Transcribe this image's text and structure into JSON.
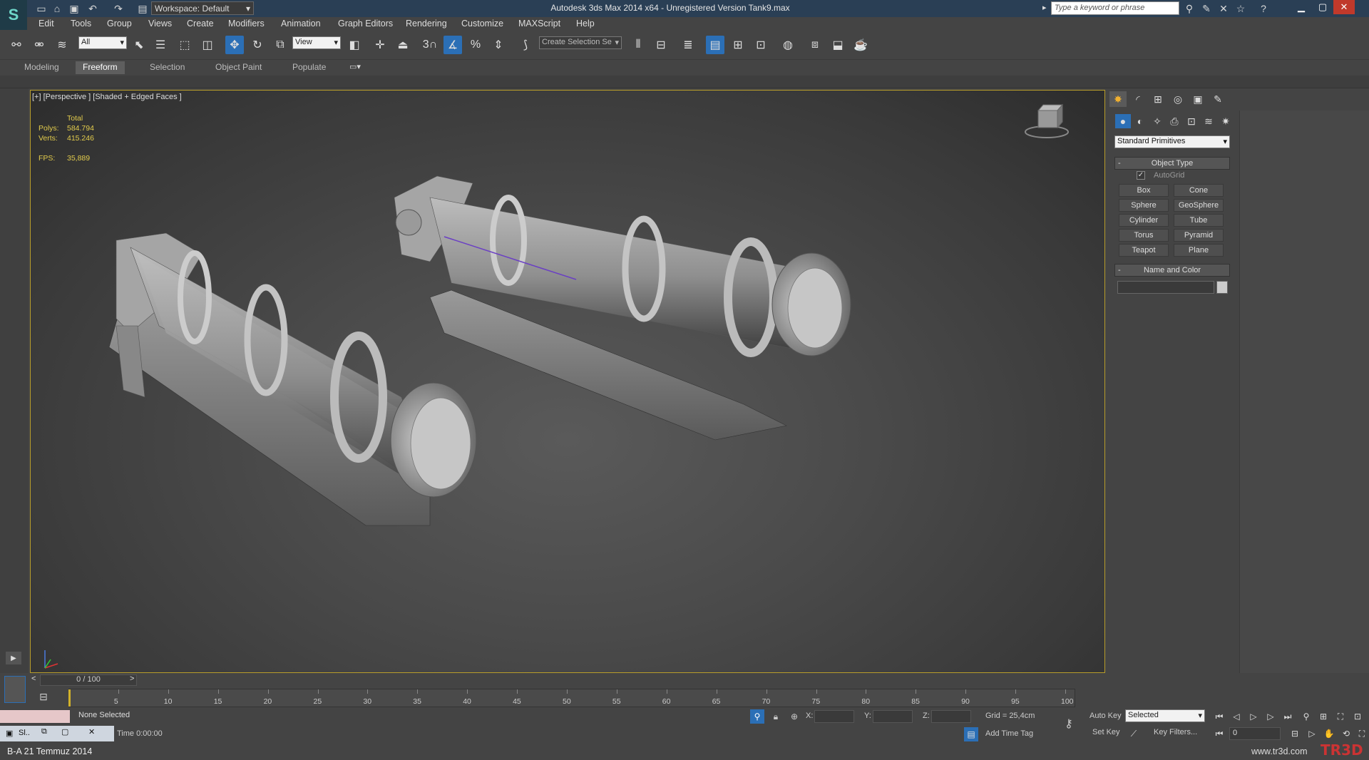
{
  "window": {
    "title": "Autodesk 3ds Max  2014 x64  -  Unregistered Version    Tank9.max",
    "workspace_label": "Workspace: Default",
    "search_placeholder": "Type a keyword or phrase"
  },
  "menu": [
    "Edit",
    "Tools",
    "Group",
    "Views",
    "Create",
    "Modifiers",
    "Animation",
    "Graph Editors",
    "Rendering",
    "Customize",
    "MAXScript",
    "Help"
  ],
  "toolbar": {
    "filter_value": "All",
    "refcoord_value": "View",
    "snap_label": "3",
    "percent_label": "%",
    "selection_set_placeholder": "Create Selection Se"
  },
  "ribbon": {
    "tabs": [
      "Modeling",
      "Freeform",
      "Selection",
      "Object Paint",
      "Populate"
    ],
    "active": "Freeform"
  },
  "viewport": {
    "label": "[+] [Perspective ] [Shaded + Edged Faces ]",
    "stats": {
      "total_label": "Total",
      "polys_label": "Polys:",
      "polys": "584.794",
      "verts_label": "Verts:",
      "verts": "415.246",
      "fps_label": "FPS:",
      "fps": "35,889"
    }
  },
  "command_panel": {
    "category": "Standard Primitives",
    "object_type_title": "Object Type",
    "autogrid_label": "AutoGrid",
    "autogrid_checked": true,
    "buttons": [
      "Box",
      "Cone",
      "Sphere",
      "GeoSphere",
      "Cylinder",
      "Tube",
      "Torus",
      "Pyramid",
      "Teapot",
      "Plane"
    ],
    "name_color_title": "Name and Color",
    "name_value": "",
    "collapse_symbol": "-"
  },
  "timeline": {
    "slider_label": "0 / 100",
    "ticks": [
      "5",
      "10",
      "15",
      "20",
      "25",
      "30",
      "35",
      "40",
      "45",
      "50",
      "55",
      "60",
      "65",
      "70",
      "75",
      "80",
      "85",
      "90",
      "95",
      "100"
    ],
    "prev": "<",
    "next": ">"
  },
  "status": {
    "selection_text": "None Selected",
    "x_label": "X:",
    "y_label": "Y:",
    "z_label": "Z:",
    "x_value": "",
    "y_value": "",
    "z_value": "",
    "grid_text": "Grid = 25,4cm",
    "time_text": "Time  0:00:00",
    "add_time_tag": "Add Time Tag",
    "auto_key": "Auto Key",
    "set_key": "Set Key",
    "key_mode_value": "Selected",
    "key_filters": "Key Filters...",
    "frame_value": "0",
    "taskbar_label": "Sl.."
  },
  "caption": "B-A 21 Temmuz 2014",
  "watermark": "www.tr3d.com",
  "colors": {
    "accent_blue": "#2b6fb6",
    "stats_yellow": "#e3cc4c",
    "viewport_border": "#b89d2a",
    "title_bar": "#2a3f55"
  }
}
